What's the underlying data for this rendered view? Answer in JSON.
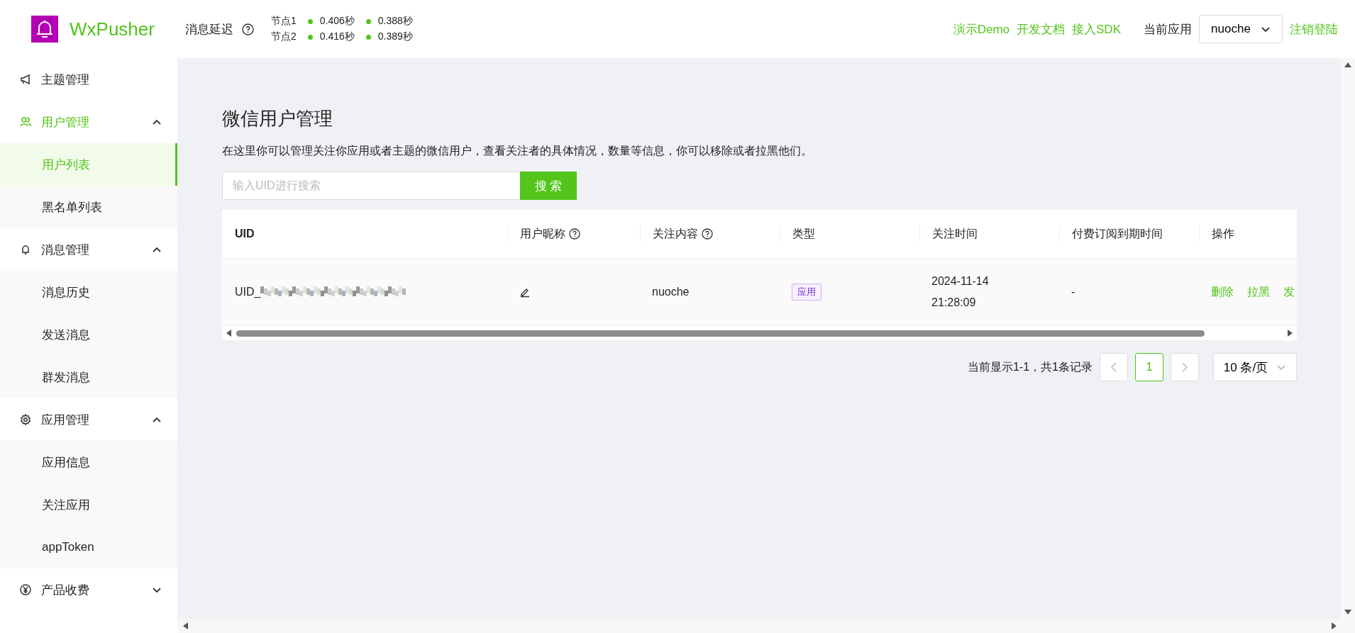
{
  "header": {
    "logo_text": "WxPusher",
    "latency_label": "消息延迟",
    "nodes": [
      {
        "name": "节点1",
        "readings": [
          "0.406秒",
          "0.388秒"
        ]
      },
      {
        "name": "节点2",
        "readings": [
          "0.416秒",
          "0.389秒"
        ]
      }
    ],
    "links": [
      "演示Demo",
      "开发文档",
      "接入SDK"
    ],
    "app_label": "当前应用",
    "app_select": "nuoche",
    "logout": "注销登陆"
  },
  "sidebar": {
    "items": [
      {
        "kind": "item",
        "label": "主题管理",
        "active": false
      },
      {
        "kind": "group",
        "label": "用户管理",
        "active": true,
        "expanded": true,
        "children": [
          {
            "label": "用户列表",
            "selected": true
          },
          {
            "label": "黑名单列表",
            "selected": false
          }
        ]
      },
      {
        "kind": "group",
        "label": "消息管理",
        "active": false,
        "expanded": true,
        "children": [
          {
            "label": "消息历史",
            "selected": false
          },
          {
            "label": "发送消息",
            "selected": false
          },
          {
            "label": "群发消息",
            "selected": false
          }
        ]
      },
      {
        "kind": "group",
        "label": "应用管理",
        "active": false,
        "expanded": true,
        "children": [
          {
            "label": "应用信息",
            "selected": false
          },
          {
            "label": "关注应用",
            "selected": false
          },
          {
            "label": "appToken",
            "selected": false
          }
        ]
      },
      {
        "kind": "group",
        "label": "产品收费",
        "active": false,
        "expanded": false
      }
    ]
  },
  "page": {
    "title": "微信用户管理",
    "description": "在这里你可以管理关注你应用或者主题的微信用户，查看关注者的具体情况，数量等信息，你可以移除或者拉黑他们。",
    "search": {
      "placeholder": "输入UID进行搜索",
      "button": "搜 索"
    }
  },
  "table": {
    "columns": [
      {
        "label": "UID",
        "help": false
      },
      {
        "label": "用户昵称",
        "help": true
      },
      {
        "label": "关注内容",
        "help": true
      },
      {
        "label": "类型",
        "help": false
      },
      {
        "label": "关注时间",
        "help": false
      },
      {
        "label": "付费订阅到期时间",
        "help": false
      },
      {
        "label": "操作",
        "help": false
      }
    ],
    "rows": [
      {
        "uid": "UID_",
        "content": "nuoche",
        "type": "应用",
        "time": [
          "2024-11-14",
          "21:28:09"
        ],
        "expiry": "-",
        "actions": [
          "删除",
          "拉黑",
          "发"
        ]
      }
    ]
  },
  "pagination": {
    "summary": "当前显示1-1，共1条记录",
    "pages": [
      {
        "label": "1",
        "selected": true
      }
    ],
    "page_size": "10 条/页"
  }
}
